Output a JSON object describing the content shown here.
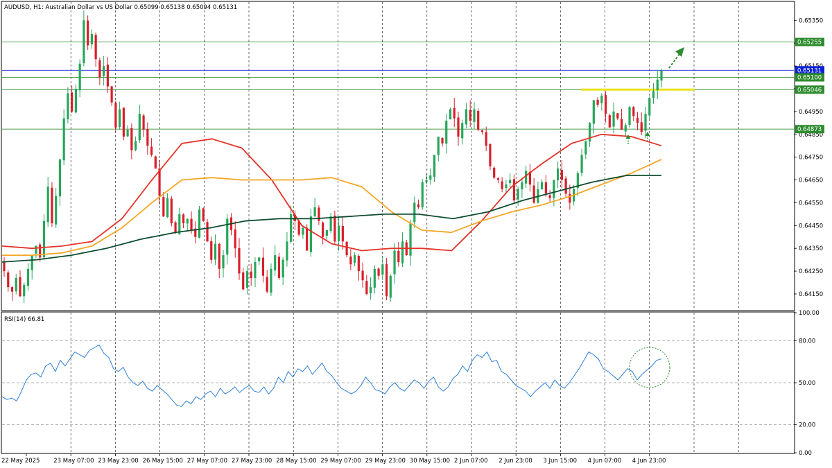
{
  "symbol_info": {
    "symbol": "AUDUSD",
    "timeframe": "H1",
    "description": "Australian Dollar vs US Dollar",
    "ohlc": [
      "0.65099",
      "0.65138",
      "0.65094",
      "0.65131"
    ]
  },
  "rsi_label": "RSI(14) 66.81",
  "chart_data": [
    {
      "type": "candlestick",
      "title": "AUDUSD, H1:  Australian Dollar vs US Dollar",
      "ylim": [
        0.6408,
        0.6543
      ],
      "y_ticks": [
        "0.65350",
        "0.65250",
        "0.65150",
        "0.65050",
        "0.64950",
        "0.64850",
        "0.64750",
        "0.64650",
        "0.64550",
        "0.64450",
        "0.64350",
        "0.64250",
        "0.64150"
      ],
      "x_tick_labels": [
        "22 May 2025",
        "23 May 07:00",
        "23 May 23:00",
        "26 May 15:00",
        "27 May 07:00",
        "27 May 23:00",
        "28 May 15:00",
        "29 May 07:00",
        "29 May 23:00",
        "30 May 15:00",
        "2 Jun 07:00",
        "2 Jun 23:00",
        "3 Jun 15:00",
        "4 Jun 07:00",
        "4 Jun 23:00"
      ],
      "bull_color": "#26a65b",
      "bear_color": "#d81e2a",
      "close_path": [
        0.6425,
        0.6418,
        0.6416,
        0.6422,
        0.6414,
        0.6419,
        0.6426,
        0.6432,
        0.6436,
        0.6431,
        0.6447,
        0.6462,
        0.6446,
        0.6458,
        0.6474,
        0.6492,
        0.6503,
        0.6495,
        0.6505,
        0.6516,
        0.6535,
        0.6524,
        0.6529,
        0.6518,
        0.651,
        0.6515,
        0.6506,
        0.6499,
        0.6488,
        0.6496,
        0.6484,
        0.6487,
        0.6478,
        0.6482,
        0.6494,
        0.6487,
        0.648,
        0.6476,
        0.647,
        0.6458,
        0.6449,
        0.6457,
        0.6446,
        0.6442,
        0.645,
        0.6446,
        0.6448,
        0.6443,
        0.644,
        0.6452,
        0.6447,
        0.6438,
        0.643,
        0.6437,
        0.6426,
        0.6432,
        0.6448,
        0.6443,
        0.6435,
        0.6424,
        0.6417,
        0.6425,
        0.6422,
        0.6429,
        0.6431,
        0.6423,
        0.6416,
        0.6426,
        0.6432,
        0.6422,
        0.643,
        0.6438,
        0.645,
        0.6447,
        0.6441,
        0.6444,
        0.6434,
        0.6449,
        0.6453,
        0.6447,
        0.644,
        0.6443,
        0.6449,
        0.6438,
        0.6445,
        0.6438,
        0.6432,
        0.6428,
        0.6432,
        0.6425,
        0.6421,
        0.6415,
        0.6418,
        0.6426,
        0.6423,
        0.6428,
        0.6414,
        0.6423,
        0.6434,
        0.6429,
        0.6438,
        0.6432,
        0.6446,
        0.6455,
        0.6453,
        0.6464,
        0.6465,
        0.6467,
        0.6476,
        0.6484,
        0.6481,
        0.6491,
        0.6496,
        0.6492,
        0.6484,
        0.649,
        0.6496,
        0.6491,
        0.6496,
        0.6487,
        0.6486,
        0.648,
        0.6471,
        0.6466,
        0.6465,
        0.6461,
        0.6463,
        0.6465,
        0.6456,
        0.6461,
        0.6464,
        0.6469,
        0.6463,
        0.6455,
        0.6461,
        0.6464,
        0.6459,
        0.6457,
        0.6465,
        0.647,
        0.6465,
        0.6459,
        0.6455,
        0.6461,
        0.6468,
        0.6476,
        0.6482,
        0.649,
        0.65,
        0.6498,
        0.6502,
        0.6494,
        0.6488,
        0.6495,
        0.6492,
        0.6487,
        0.6489,
        0.6497,
        0.6493,
        0.649,
        0.6486,
        0.6494,
        0.6501,
        0.6504,
        0.6509,
        0.6513
      ]
    },
    {
      "type": "line",
      "title": "RSI(14) 66.81",
      "ylim": [
        0,
        100
      ],
      "y_ticks": [
        "100.00",
        "80.00",
        "50.00",
        "20.00",
        "0.00"
      ],
      "series": [
        {
          "values": [
            40,
            38,
            39,
            37,
            44,
            52,
            56,
            57,
            54,
            62,
            64,
            58,
            66,
            62,
            67,
            72,
            70,
            68,
            73,
            75,
            77,
            71,
            68,
            60,
            58,
            61,
            54,
            50,
            48,
            51,
            46,
            44,
            48,
            45,
            42,
            38,
            34,
            33,
            37,
            35,
            40,
            38,
            42,
            44,
            40,
            46,
            42,
            44,
            47,
            43,
            46,
            48,
            44,
            43,
            47,
            42,
            46,
            54,
            50,
            58,
            54,
            60,
            58,
            62,
            56,
            60,
            64,
            58,
            55,
            50,
            46,
            44,
            42,
            44,
            48,
            54,
            50,
            45,
            44,
            42,
            47,
            50,
            46,
            44,
            48,
            52,
            50,
            46,
            51,
            54,
            47,
            44,
            47,
            53,
            56,
            62,
            58,
            66,
            70,
            68,
            72,
            65,
            66,
            58,
            56,
            52,
            48,
            46,
            44,
            40,
            44,
            47,
            50,
            46,
            52,
            48,
            46,
            50,
            55,
            60,
            66,
            72,
            70,
            67,
            60,
            58,
            55,
            52,
            56,
            60,
            58,
            52,
            56,
            59,
            62,
            66,
            67
          ]
        }
      ]
    }
  ],
  "moving_averages": [
    {
      "color": "#e53227",
      "points": [
        0.6436,
        0.6435,
        0.6436,
        0.6438,
        0.6448,
        0.6465,
        0.6481,
        0.6483,
        0.6479,
        0.6465,
        0.6445,
        0.6437,
        0.6434,
        0.6435,
        0.6435,
        0.6434,
        0.6447,
        0.6462,
        0.6472,
        0.6481,
        0.6485,
        0.6484,
        0.648
      ]
    },
    {
      "color": "#f5a623",
      "points": [
        0.6432,
        0.6432,
        0.6433,
        0.6436,
        0.6444,
        0.6455,
        0.6465,
        0.6466,
        0.6465,
        0.6465,
        0.6465,
        0.6466,
        0.6462,
        0.6451,
        0.6443,
        0.6442,
        0.6447,
        0.6451,
        0.6454,
        0.6458,
        0.6463,
        0.6468,
        0.6474
      ]
    },
    {
      "color": "#0e4d2f",
      "points": [
        0.6429,
        0.643,
        0.6432,
        0.6435,
        0.6439,
        0.6442,
        0.6444,
        0.6447,
        0.6448,
        0.6448,
        0.6449,
        0.645,
        0.645,
        0.6448,
        0.6451,
        0.6456,
        0.646,
        0.6464,
        0.6467,
        0.6467
      ]
    }
  ],
  "horizontal_levels": [
    {
      "value": "0.65255",
      "color": "#2e8b2e"
    },
    {
      "value": "0.65131",
      "color": "#0a1fd6"
    },
    {
      "value": "0.65100",
      "color": "#2e8b2e"
    },
    {
      "value": "0.65046",
      "color": "#2e8b2e"
    },
    {
      "value": "0.64873",
      "color": "#2e8b2e"
    }
  ],
  "resistance_zone": {
    "value": 0.65046,
    "color": "#e9e21a"
  }
}
